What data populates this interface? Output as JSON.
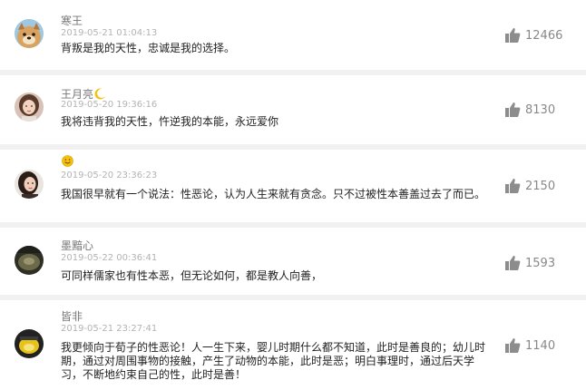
{
  "comments": [
    {
      "username": "寒王",
      "time": "2019-05-21 01:04:13",
      "text": "背叛是我的天性，忠诚是我的选择。",
      "likes": "12466",
      "avatar_icon": "dog-avatar"
    },
    {
      "username": "王月亮",
      "username_emoji": "crescent-moon-icon",
      "time": "2019-05-20 19:36:16",
      "text": "我将违背我的天性，忤逆我的本能，永远爱你",
      "likes": "8130",
      "avatar_icon": "girl-avatar"
    },
    {
      "username": "",
      "username_emoji": "smiley-face-icon",
      "time": "2019-05-20 23:36:23",
      "text": "我国很早就有一个说法：性恶论，认为人生来就有贪念。只不过被性本善盖过去了而已。",
      "likes": "2150",
      "avatar_icon": "woman-avatar"
    },
    {
      "username": "墨黯心",
      "time": "2019-05-22 00:36:41",
      "text": "可同样儒家也有性本恶，但无论如何，都是教人向善，",
      "likes": "1593",
      "avatar_icon": "dark-avatar"
    },
    {
      "username": "皆非",
      "time": "2019-05-21 23:27:41",
      "text": "我更倾向于荀子的性恶论！人一生下来，婴儿时期什么都不知道，此时是善良的；幼儿时期，通过对周围事物的接触，产生了动物的本能，此时是恶；明白事理时，通过后天学习，不断地约束自己的性，此时是善！",
      "likes": "1140",
      "avatar_icon": "yellow-avatar"
    }
  ],
  "colors": {
    "background": "#f1f1f1",
    "card": "#ffffff",
    "username": "#777777",
    "time": "#b3b3b3",
    "text": "#222222",
    "like_icon": "#8c8c8c"
  }
}
